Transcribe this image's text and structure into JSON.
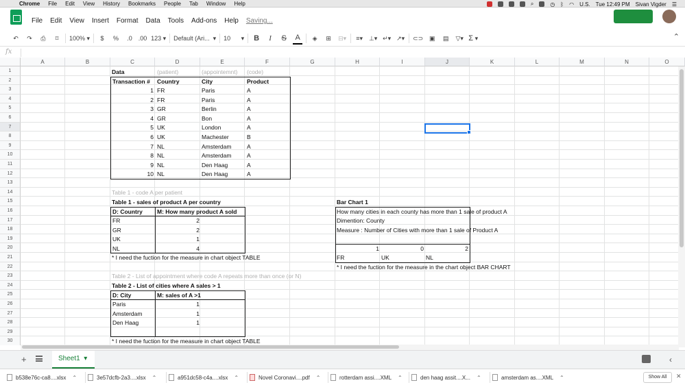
{
  "macbar": {
    "app": "Chrome",
    "menus": [
      "File",
      "Edit",
      "View",
      "History",
      "Bookmarks",
      "People",
      "Tab",
      "Window",
      "Help"
    ],
    "input_source": "U.S.",
    "clock": "Tue 12:49 PM",
    "user": "Sivan Vigder"
  },
  "doc": {
    "menus": [
      "File",
      "Edit",
      "View",
      "Insert",
      "Format",
      "Data",
      "Tools",
      "Add-ons",
      "Help"
    ],
    "saving": "Saving..."
  },
  "toolbar": {
    "zoom": "100%",
    "currency": "$",
    "percent": "%",
    "dec_less": ".0",
    "dec_more": ".00",
    "more_formats": "123",
    "font": "Default (Ari...",
    "font_size": "10",
    "bold": "B",
    "italic": "I",
    "strike": "S",
    "text_color": "A",
    "functions": "Σ"
  },
  "formula": {
    "fx": "fx"
  },
  "columns": [
    "A",
    "B",
    "C",
    "D",
    "E",
    "F",
    "G",
    "H",
    "I",
    "J",
    "K",
    "L",
    "M",
    "N",
    "O"
  ],
  "rows": [
    "1",
    "2",
    "3",
    "4",
    "5",
    "6",
    "7",
    "8",
    "9",
    "10",
    "11",
    "12",
    "13",
    "14",
    "15",
    "16",
    "17",
    "18",
    "19",
    "20",
    "21",
    "22",
    "23",
    "24",
    "25",
    "26",
    "27",
    "28",
    "29",
    "30"
  ],
  "table_main": {
    "title": "Data",
    "hint_patient": "(patient)",
    "hint_appointment": "(appointemnt)",
    "hint_code": "(code)",
    "headers": [
      "Transaction #",
      "Country",
      "City",
      "Product"
    ],
    "rows": [
      [
        "1",
        "FR",
        "Paris",
        "A"
      ],
      [
        "2",
        "FR",
        "Paris",
        "A"
      ],
      [
        "3",
        "GR",
        "Berlin",
        "A"
      ],
      [
        "4",
        "GR",
        "Bon",
        "A"
      ],
      [
        "5",
        "UK",
        "London",
        "A"
      ],
      [
        "6",
        "UK",
        "Machester",
        "B"
      ],
      [
        "7",
        "NL",
        "Amsterdam",
        "A"
      ],
      [
        "8",
        "NL",
        "Amsterdam",
        "A"
      ],
      [
        "9",
        "NL",
        "Den Haag",
        "A"
      ],
      [
        "10",
        "NL",
        "Den Haag",
        "A"
      ]
    ]
  },
  "table1": {
    "hint": "Table 1 - code A per patient",
    "title": "Table 1 - sales of product A per country",
    "headers": [
      "D: Country",
      "M: How many product A sold"
    ],
    "rows": [
      [
        "FR",
        "2"
      ],
      [
        "GR",
        "2"
      ],
      [
        "UK",
        "1"
      ],
      [
        "NL",
        "4"
      ]
    ],
    "note": "* I need the fuction for the measure in chart object TABLE"
  },
  "barchart": {
    "title": "Bar Chart 1",
    "line1": "How many cities in each county has more than 1 sale of product A",
    "line2": "Dimention: County",
    "line3": "Measure : Number of Cities with more than 1 sale of Product A",
    "values": [
      "1",
      "0",
      "2"
    ],
    "labels": [
      "FR",
      "UK",
      "NL"
    ],
    "note": "* I need the fuction for the measure in the chart object  BAR CHART"
  },
  "table2": {
    "hint": "Table 2 -  List of appointment where code A  repeats more than once (or N)",
    "title": "Table 2 -  List of cities where A sales > 1",
    "headers": [
      "D: City",
      "M: sales of A >1"
    ],
    "rows": [
      [
        "Paris",
        "1"
      ],
      [
        "Amsterdam",
        "1"
      ],
      [
        "Den Haag",
        "1"
      ]
    ],
    "note": "* I need the fuction for the measure in chart object TABLE"
  },
  "sheet_tab": "Sheet1",
  "downloads": [
    {
      "name": "b538e76c-ca8....xlsx",
      "icon": "xlsx-file-icon"
    },
    {
      "name": "3e57dcfb-2a3....xlsx",
      "icon": "xlsx-file-icon"
    },
    {
      "name": "a951dc58-c4a....xlsx",
      "icon": "xlsx-file-icon"
    },
    {
      "name": "Novel Coronavi....pdf",
      "icon": "pdf-file-icon"
    },
    {
      "name": "rotterdam assi....XML",
      "icon": "xml-file-icon"
    },
    {
      "name": "den haag assit....X...",
      "icon": "xml-file-icon"
    },
    {
      "name": "amsterdam as....XML",
      "icon": "xml-file-icon"
    }
  ],
  "show_all": "Show All",
  "colors": {
    "accent": "#1e8e3e",
    "selection": "#1a73e8",
    "tab": "#188038"
  }
}
